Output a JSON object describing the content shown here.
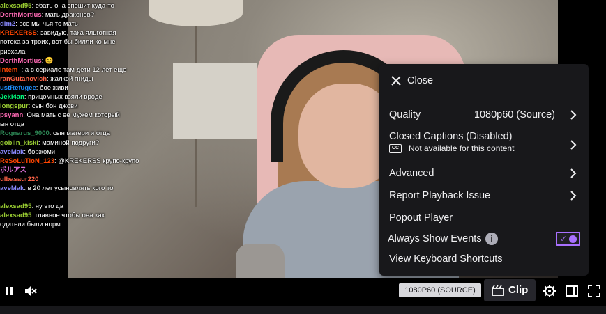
{
  "chat": {
    "lines": [
      {
        "user": "alexsad95",
        "text": "ебать она спешит куда-то",
        "color": "#9acd32"
      },
      {
        "user": "DorthMortius",
        "text": "мать драконов?",
        "color": "#ff69b4"
      },
      {
        "user": "dim2",
        "text": "все мы чья то мать",
        "color": "#8a8aff"
      },
      {
        "user": "KREKERSS",
        "text": "завидую, така яльготная",
        "color": "#ff4500"
      },
      {
        "user": "",
        "text": "потека за троих, вот бы билли ко мне",
        "color": "#ffffff"
      },
      {
        "user": "",
        "text": "риехала",
        "color": "#ffffff"
      },
      {
        "user": "DorthMortius",
        "text": "😊",
        "color": "#ff69b4"
      },
      {
        "user": "intem_",
        "text": "а в сериале там дети 12 лет еще",
        "color": "#ff4500"
      },
      {
        "user": "ranGutanovich",
        "text": "жалкой гниды",
        "color": "#ff6347"
      },
      {
        "user": "ustRefugee",
        "text": "бое живи",
        "color": "#1e90ff"
      },
      {
        "user": "Jekl4an",
        "text": "прицомных взяли вроде",
        "color": "#00ff7f"
      },
      {
        "user": "longspur",
        "text": "сын бон джови",
        "color": "#9acd32"
      },
      {
        "user": "psyann",
        "text": "Она мать с ее мужем который",
        "color": "#ff69b4"
      },
      {
        "user": "",
        "text": "ын отца",
        "color": "#ffffff"
      },
      {
        "user": "Rognarus_9000",
        "text": "сын матери и отца",
        "color": "#2e8b57"
      },
      {
        "user": "goblin_kiski",
        "text": "маминой подруги?",
        "color": "#9acd32"
      },
      {
        "user": "aveMak",
        "text": "боржоми",
        "color": "#8a8aff"
      },
      {
        "user": "ReSoLuTioN_123",
        "text": "@KREKERSS крупо-крупо",
        "color": "#ff4500"
      },
      {
        "user": "ボルアス",
        "text": "",
        "color": "#da70d6"
      },
      {
        "user": "ulbasaur220",
        "text": "",
        "color": "#ff6347"
      },
      {
        "user": "aveMak",
        "text": "в 20 лет усыновлять кого то",
        "color": "#8a8aff"
      },
      {
        "user": "",
        "text": "",
        "color": "#ffffff"
      },
      {
        "user": "alexsad95",
        "text": "ну это да",
        "color": "#9acd32"
      },
      {
        "user": "alexsad95",
        "text": "главное чтобы она как",
        "color": "#9acd32"
      },
      {
        "user": "",
        "text": "одители были норм",
        "color": "#ffffff"
      }
    ]
  },
  "menu": {
    "close_label": "Close",
    "quality_label": "Quality",
    "quality_value": "1080p60 (Source)",
    "captions_label": "Closed Captions (Disabled)",
    "captions_sub": "Not available for this content",
    "cc_icon_text": "CC",
    "advanced_label": "Advanced",
    "report_label": "Report Playback Issue",
    "popout_label": "Popout Player",
    "always_show_label": "Always Show Events",
    "always_show_on": true,
    "shortcuts_label": "View Keyboard Shortcuts",
    "accent": "#a970ff"
  },
  "controls": {
    "quality_badge": "1080P60 (SOURCE)",
    "clip_label": "Clip",
    "icons": [
      "pause-icon",
      "mute-icon",
      "clip-icon",
      "settings-icon",
      "theatre-mode-icon",
      "fullscreen-icon"
    ]
  }
}
